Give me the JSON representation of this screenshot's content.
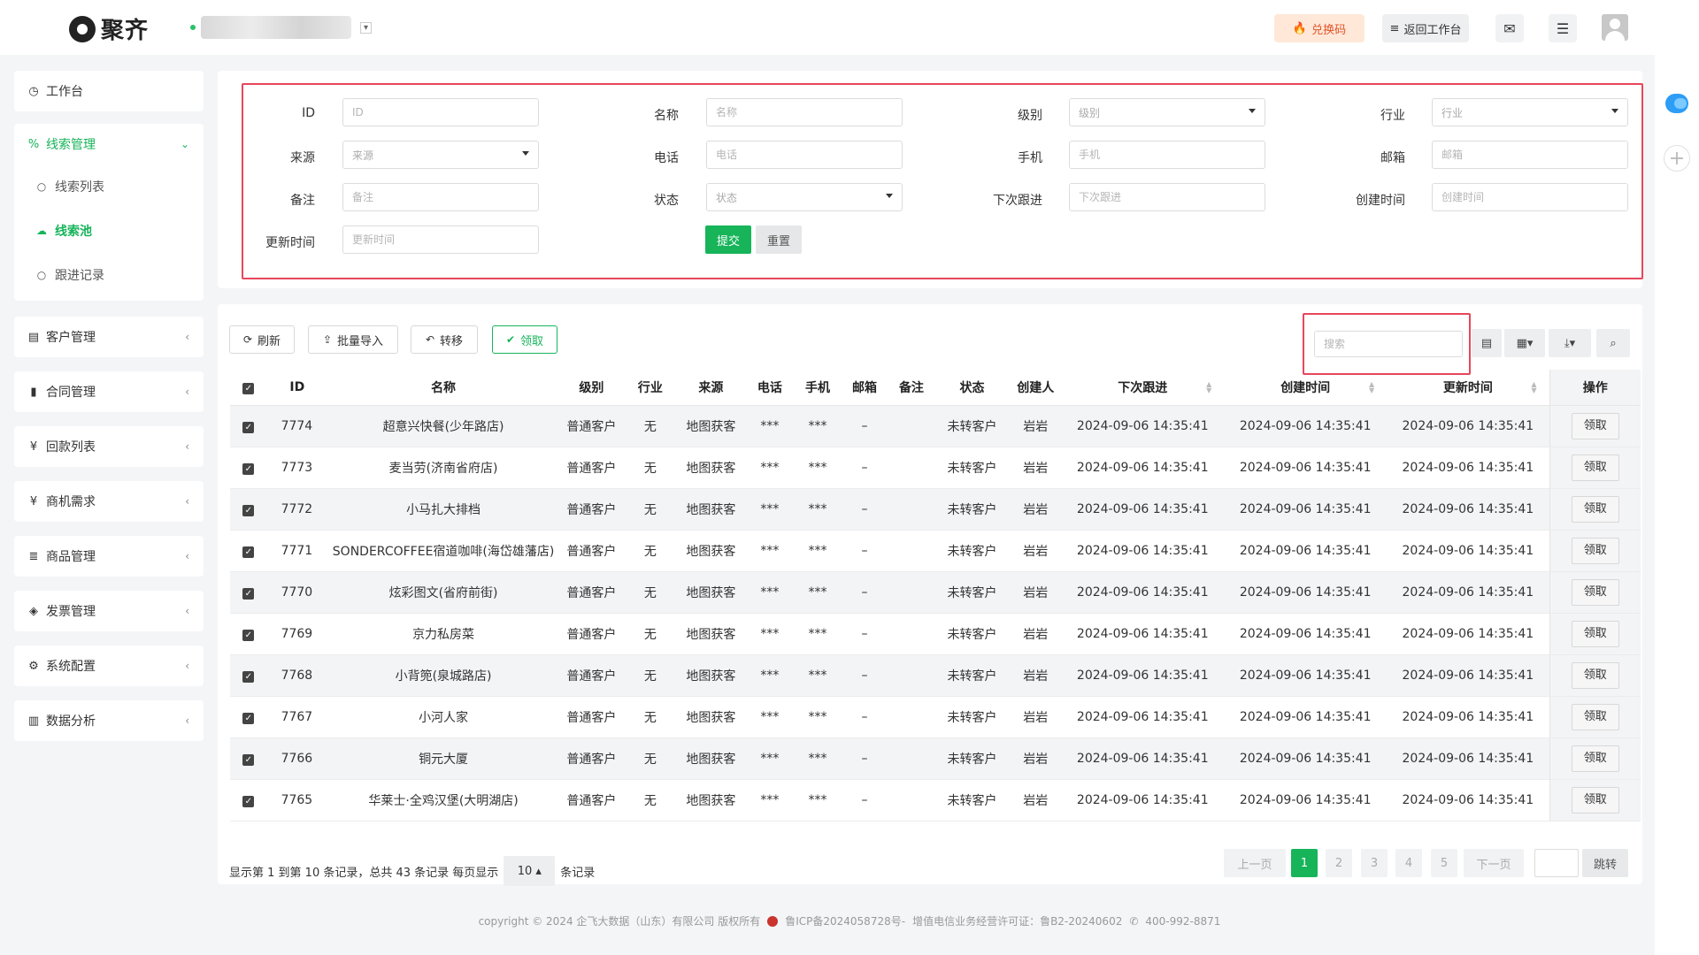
{
  "header": {
    "brand": "聚齐",
    "org_caret": "▾",
    "exchange_label": "兑换码",
    "return_label": "返回工作台",
    "mail_icon": "mail-icon",
    "menu_icon": "menu-icon"
  },
  "sidebar": {
    "workbench": "工作台",
    "lead_mgmt": "线索管理",
    "lead_sub": [
      "线索列表",
      "线索池",
      "跟进记录"
    ],
    "groups": [
      "客户管理",
      "合同管理",
      "回款列表",
      "商机需求",
      "商品管理",
      "发票管理",
      "系统配置",
      "数据分析"
    ]
  },
  "filters": {
    "row1": [
      {
        "label": "ID",
        "placeholder": "ID",
        "select": false
      },
      {
        "label": "名称",
        "placeholder": "名称",
        "select": false
      },
      {
        "label": "级别",
        "placeholder": "级别",
        "select": true
      },
      {
        "label": "行业",
        "placeholder": "行业",
        "select": true
      }
    ],
    "row2": [
      {
        "label": "来源",
        "placeholder": "来源",
        "select": true
      },
      {
        "label": "电话",
        "placeholder": "电话",
        "select": false
      },
      {
        "label": "手机",
        "placeholder": "手机",
        "select": false
      },
      {
        "label": "邮箱",
        "placeholder": "邮箱",
        "select": false
      }
    ],
    "row3": [
      {
        "label": "备注",
        "placeholder": "备注",
        "select": false
      },
      {
        "label": "状态",
        "placeholder": "状态",
        "select": true
      },
      {
        "label": "下次跟进",
        "placeholder": "下次跟进",
        "select": false
      },
      {
        "label": "创建时间",
        "placeholder": "创建时间",
        "select": false
      }
    ],
    "row4": [
      {
        "label": "更新时间",
        "placeholder": "更新时间",
        "select": false
      }
    ],
    "submit": "提交",
    "reset": "重置"
  },
  "toolbar": {
    "refresh": "刷新",
    "import": "批量导入",
    "transfer": "转移",
    "claim": "领取",
    "search_placeholder": "搜索"
  },
  "table": {
    "columns": [
      "ID",
      "名称",
      "级别",
      "行业",
      "来源",
      "电话",
      "手机",
      "邮箱",
      "备注",
      "状态",
      "创建人",
      "下次跟进",
      "创建时间",
      "更新时间",
      "操作"
    ],
    "rows": [
      {
        "id": "7774",
        "name": "超意兴快餐(少年路店)",
        "level": "普通客户",
        "industry": "无",
        "source": "地图获客",
        "phone": "***",
        "mobile": "***",
        "email": "–",
        "note": "",
        "status": "未转客户",
        "creator": "岩岩",
        "next": "2024-09-06 14:35:41",
        "created": "2024-09-06 14:35:41",
        "updated": "2024-09-06 14:35:41",
        "op": "领取"
      },
      {
        "id": "7773",
        "name": "麦当劳(济南省府店)",
        "level": "普通客户",
        "industry": "无",
        "source": "地图获客",
        "phone": "***",
        "mobile": "***",
        "email": "–",
        "note": "",
        "status": "未转客户",
        "creator": "岩岩",
        "next": "2024-09-06 14:35:41",
        "created": "2024-09-06 14:35:41",
        "updated": "2024-09-06 14:35:41",
        "op": "领取"
      },
      {
        "id": "7772",
        "name": "小马扎大排档",
        "level": "普通客户",
        "industry": "无",
        "source": "地图获客",
        "phone": "***",
        "mobile": "***",
        "email": "–",
        "note": "",
        "status": "未转客户",
        "creator": "岩岩",
        "next": "2024-09-06 14:35:41",
        "created": "2024-09-06 14:35:41",
        "updated": "2024-09-06 14:35:41",
        "op": "领取"
      },
      {
        "id": "7771",
        "name": "SONDERCOFFEE宿道咖啡(海岱雄藩店)",
        "level": "普通客户",
        "industry": "无",
        "source": "地图获客",
        "phone": "***",
        "mobile": "***",
        "email": "–",
        "note": "",
        "status": "未转客户",
        "creator": "岩岩",
        "next": "2024-09-06 14:35:41",
        "created": "2024-09-06 14:35:41",
        "updated": "2024-09-06 14:35:41",
        "op": "领取"
      },
      {
        "id": "7770",
        "name": "炫彩图文(省府前街)",
        "level": "普通客户",
        "industry": "无",
        "source": "地图获客",
        "phone": "***",
        "mobile": "***",
        "email": "–",
        "note": "",
        "status": "未转客户",
        "creator": "岩岩",
        "next": "2024-09-06 14:35:41",
        "created": "2024-09-06 14:35:41",
        "updated": "2024-09-06 14:35:41",
        "op": "领取"
      },
      {
        "id": "7769",
        "name": "京力私房菜",
        "level": "普通客户",
        "industry": "无",
        "source": "地图获客",
        "phone": "***",
        "mobile": "***",
        "email": "–",
        "note": "",
        "status": "未转客户",
        "creator": "岩岩",
        "next": "2024-09-06 14:35:41",
        "created": "2024-09-06 14:35:41",
        "updated": "2024-09-06 14:35:41",
        "op": "领取"
      },
      {
        "id": "7768",
        "name": "小背篼(泉城路店)",
        "level": "普通客户",
        "industry": "无",
        "source": "地图获客",
        "phone": "***",
        "mobile": "***",
        "email": "–",
        "note": "",
        "status": "未转客户",
        "creator": "岩岩",
        "next": "2024-09-06 14:35:41",
        "created": "2024-09-06 14:35:41",
        "updated": "2024-09-06 14:35:41",
        "op": "领取"
      },
      {
        "id": "7767",
        "name": "小河人家",
        "level": "普通客户",
        "industry": "无",
        "source": "地图获客",
        "phone": "***",
        "mobile": "***",
        "email": "–",
        "note": "",
        "status": "未转客户",
        "creator": "岩岩",
        "next": "2024-09-06 14:35:41",
        "created": "2024-09-06 14:35:41",
        "updated": "2024-09-06 14:35:41",
        "op": "领取"
      },
      {
        "id": "7766",
        "name": "铜元大厦",
        "level": "普通客户",
        "industry": "无",
        "source": "地图获客",
        "phone": "***",
        "mobile": "***",
        "email": "–",
        "note": "",
        "status": "未转客户",
        "creator": "岩岩",
        "next": "2024-09-06 14:35:41",
        "created": "2024-09-06 14:35:41",
        "updated": "2024-09-06 14:35:41",
        "op": "领取"
      },
      {
        "id": "7765",
        "name": "华莱士·全鸡汉堡(大明湖店)",
        "level": "普通客户",
        "industry": "无",
        "source": "地图获客",
        "phone": "***",
        "mobile": "***",
        "email": "–",
        "note": "",
        "status": "未转客户",
        "creator": "岩岩",
        "next": "2024-09-06 14:35:41",
        "created": "2024-09-06 14:35:41",
        "updated": "2024-09-06 14:35:41",
        "op": "领取"
      }
    ]
  },
  "pagination": {
    "info_prefix": "显示第 1 到第 10 条记录，总共 43 条记录 每页显示",
    "page_size": "10 ▴",
    "info_suffix": "条记录",
    "prev": "上一页",
    "pages": [
      "1",
      "2",
      "3",
      "4",
      "5"
    ],
    "next": "下一页",
    "jump": "跳转"
  },
  "footer": {
    "copyright": "copyright © 2024 企飞大数据（山东）有限公司 版权所有",
    "icp": "鲁ICP备2024058728号-",
    "license": "增值电信业务经营许可证：鲁B2-20240602",
    "phone": "400-992-8871"
  },
  "colors": {
    "accent": "#17b45a",
    "highlight": "#e8465c"
  }
}
